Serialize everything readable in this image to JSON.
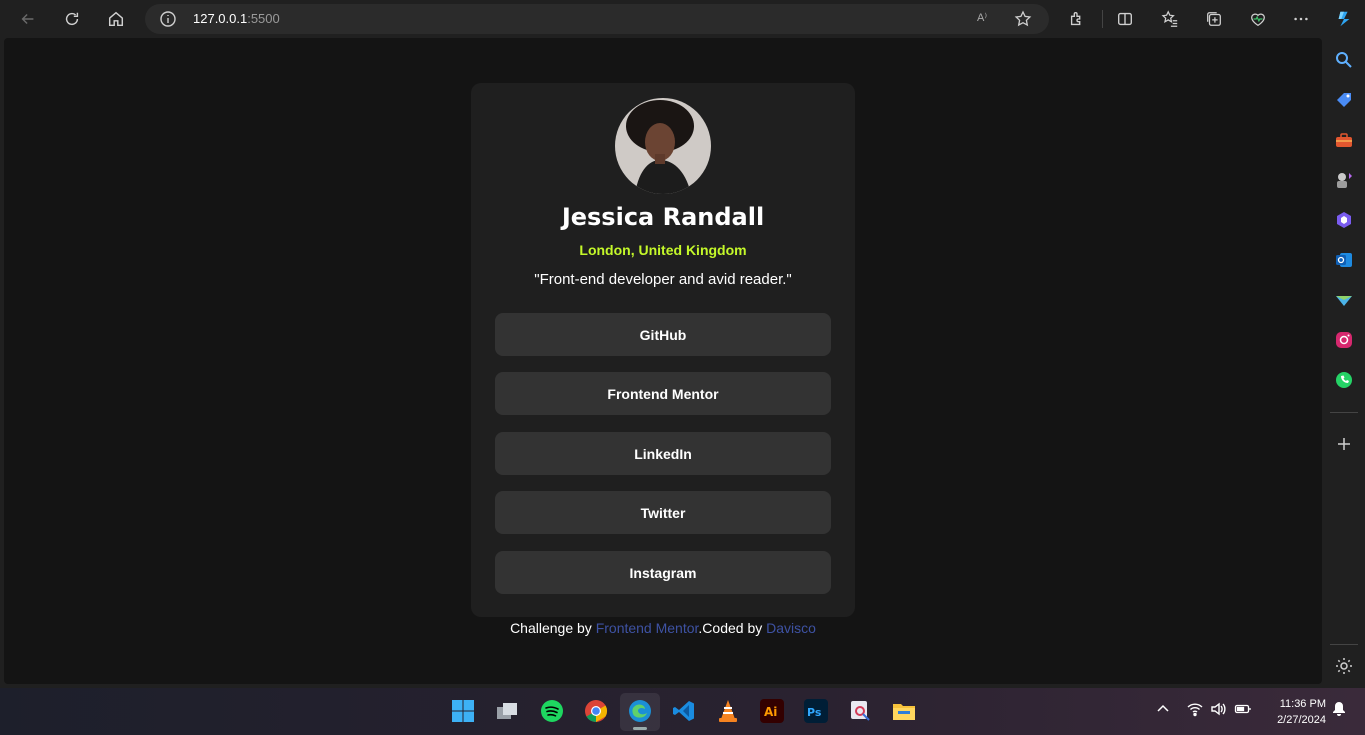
{
  "browser": {
    "url_host": "127.0.0.1",
    "url_port": ":5500",
    "read_aloud_label": "A⁾"
  },
  "profile": {
    "name": "Jessica Randall",
    "location": "London, United Kingdom",
    "bio": "\"Front-end developer and avid reader.\"",
    "links": [
      {
        "label": "GitHub"
      },
      {
        "label": "Frontend Mentor"
      },
      {
        "label": "LinkedIn"
      },
      {
        "label": "Twitter"
      },
      {
        "label": "Instagram"
      }
    ]
  },
  "attribution": {
    "prefix": "Challenge by ",
    "link1": "Frontend Mentor",
    "middle": ".Coded by ",
    "link2": "Davisco"
  },
  "taskbar": {
    "time": "11:36 PM",
    "date": "2/27/2024"
  },
  "colors": {
    "accent_location": "#c4f82a",
    "card": "#1f1f1f",
    "button": "#333333",
    "link": "#3e52a3"
  }
}
